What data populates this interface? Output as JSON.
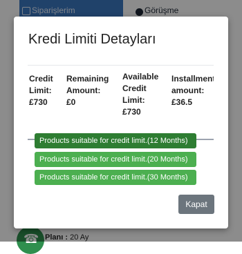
{
  "background": {
    "tabs": [
      {
        "label": "Siparişlerim",
        "icon": "box-icon"
      },
      {
        "label": "Görüşme",
        "icon": "chat-icon"
      }
    ],
    "plan_label": "Planı :",
    "plan_value": "20 Ay"
  },
  "modal": {
    "title": "Kredi Limiti Detayları",
    "columns": [
      {
        "label": "Credit Limit:",
        "value": "£730"
      },
      {
        "label": "Remaining Amount:",
        "value": "£0"
      },
      {
        "label": "Available Credit Limit:",
        "value": "£730"
      },
      {
        "label": "Installment amount:",
        "value": "£36.5"
      }
    ],
    "product_buttons": [
      "Products suitable for credit limit.(12 Months)",
      "Products suitable for credit limit.(20 Months)",
      "Products suitable for credit limit.(30 Months)"
    ],
    "close_label": "Kapat"
  },
  "colors": {
    "primary_tab": "#3b79c1",
    "green_dark": "#2e7d32",
    "green_light": "#4caf50",
    "close_button": "#6c757d"
  }
}
